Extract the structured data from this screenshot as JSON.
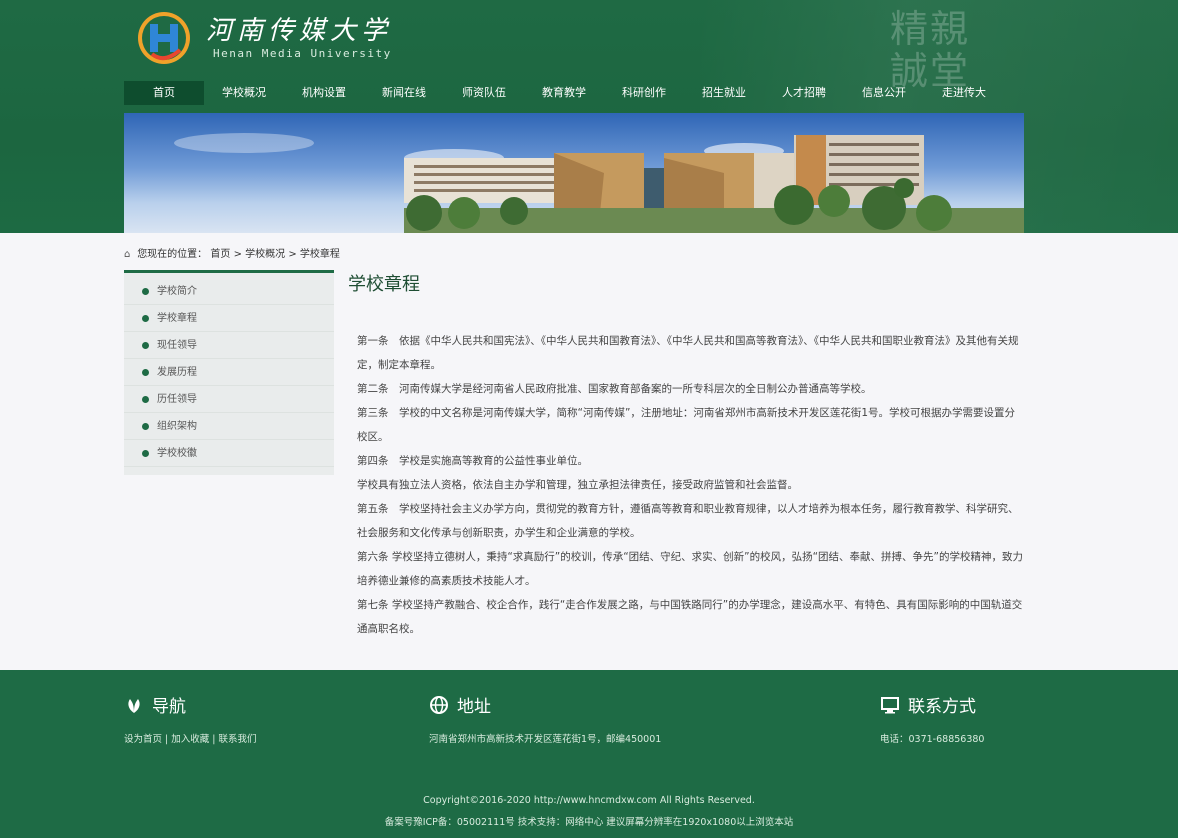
{
  "header": {
    "site_name": "河南传媒大学",
    "site_name_en": "Henan Media University",
    "deco_text": "精親誠堂"
  },
  "nav": {
    "items": [
      "首页",
      "学校概况",
      "机构设置",
      "新闻在线",
      "师资队伍",
      "教育教学",
      "科研创作",
      "招生就业",
      "人才招聘",
      "信息公开",
      "走进传大"
    ]
  },
  "breadcrumb": {
    "prefix": "您现在的位置：",
    "items": [
      "首页",
      "学校概况",
      "学校章程"
    ],
    "separator": ">"
  },
  "sidebar": {
    "items": [
      "学校简介",
      "学校章程",
      "现任领导",
      "发展历程",
      "历任领导",
      "组织架构",
      "学校校徽"
    ]
  },
  "article": {
    "title": "学校章程",
    "paragraphs": [
      "第一条　依据《中华人民共和国宪法》、《中华人民共和国教育法》、《中华人民共和国高等教育法》、《中华人民共和国职业教育法》及其他有关规定，制定本章程。",
      "第二条　河南传媒大学是经河南省人民政府批准、国家教育部备案的一所专科层次的全日制公办普通高等学校。",
      "第三条　学校的中文名称是河南传媒大学，简称“河南传媒”，注册地址：河南省郑州市高新技术开发区莲花街1号。学校可根据办学需要设置分校区。",
      "第四条　学校是实施高等教育的公益性事业单位。",
      "学校具有独立法人资格，依法自主办学和管理，独立承担法律责任，接受政府监管和社会监督。",
      "第五条　学校坚持社会主义办学方向，贯彻党的教育方针，遵循高等教育和职业教育规律，以人才培养为根本任务，履行教育教学、科学研究、社会服务和文化传承与创新职责，办学生和企业满意的学校。",
      "第六条 学校坚持立德树人，秉持“求真励行”的校训，传承“团结、守纪、求实、创新”的校风，弘扬“团结、奉献、拼搏、争先”的学校精神，致力培养德业兼修的高素质技术技能人才。",
      "第七条 学校坚持产教融合、校企合作，践行“走合作发展之路，与中国铁路同行”的办学理念，建设高水平、有特色、具有国际影响的中国轨道交通高职名校。"
    ]
  },
  "footer": {
    "nav_title": "导航",
    "nav_links": "设为首页 | 加入收藏 | 联系我们",
    "address_title": "地址",
    "address_text": "河南省郑州市高新技术开发区莲花街1号，邮编450001",
    "contact_title": "联系方式",
    "contact_text": "电话：0371-68856380",
    "copyright": "Copyright©2016-2020 http://www.hncmdxw.com All Rights Reserved.",
    "icp": "备案号豫ICP备：05002111号 技术支持：网络中心 建议屏幕分辨率在1920x1080以上浏览本站"
  },
  "colors": {
    "brand_green": "#1e6b45",
    "nav_active": "#0e4d2e",
    "content_bg": "#f6f6f9",
    "sidebar_bg": "#e9ecec"
  },
  "icons": {
    "logo": "university-logo",
    "breadcrumb": "home-icon",
    "nav_footer": "leaf-icon",
    "address_footer": "globe-icon",
    "contact_footer": "monitor-icon"
  }
}
